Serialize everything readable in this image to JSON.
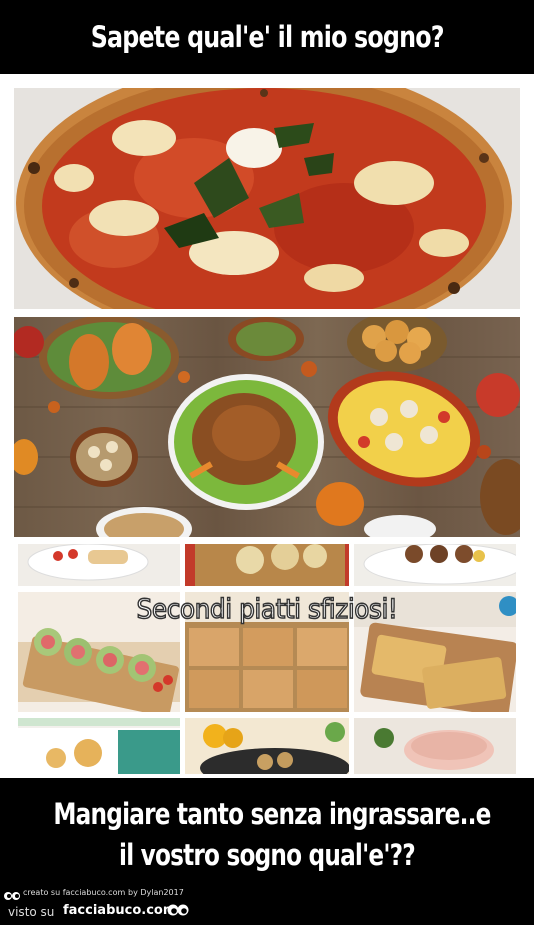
{
  "header": {
    "title": "Sapete qual'e' il mio sogno?"
  },
  "collage": {
    "caption": "Secondi piatti sfiziosi!"
  },
  "footer": {
    "line1": "Mangiare tanto senza ingrassare..e",
    "line2": "il vostro sogno qual'e'??",
    "created_on": "creato su facciabuco.com",
    "author": "by Dylan2017",
    "seen_on": "visto su",
    "site": "facciabuco.com"
  },
  "colors": {
    "background": "#000000",
    "frame": "#ffffff",
    "text": "#ffffff"
  }
}
